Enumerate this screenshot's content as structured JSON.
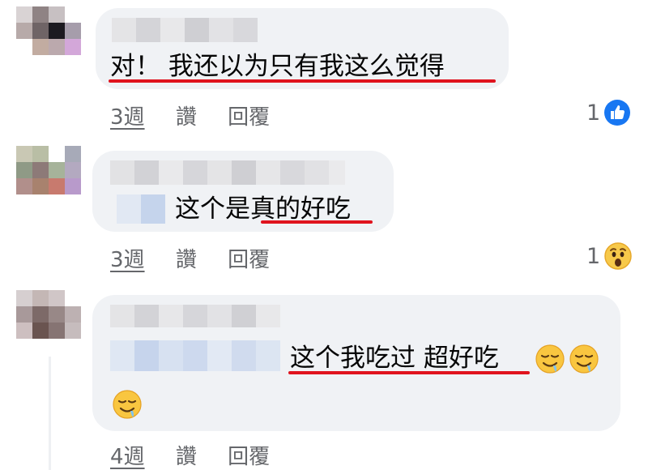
{
  "comments": [
    {
      "text": "对！ 我还以为只有我这么觉得",
      "time": "3週",
      "like_label": "讚",
      "reply_label": "回覆",
      "reaction_count": "1",
      "reaction_icon": "like-icon"
    },
    {
      "text": "这个是真的好吃",
      "time": "3週",
      "like_label": "讚",
      "reply_label": "回覆",
      "reaction_count": "1",
      "reaction_icon": "wow-icon"
    },
    {
      "text": "这个我吃过 超好吃",
      "time": "4週",
      "like_label": "讚",
      "reply_label": "回覆",
      "emoji_icon": "drooling-face-icon"
    }
  ],
  "colors": {
    "bubble": "#f0f2f5",
    "meta_text": "#65676b",
    "annotation_underline": "#e0141e",
    "like_blue": "#1877f2"
  }
}
